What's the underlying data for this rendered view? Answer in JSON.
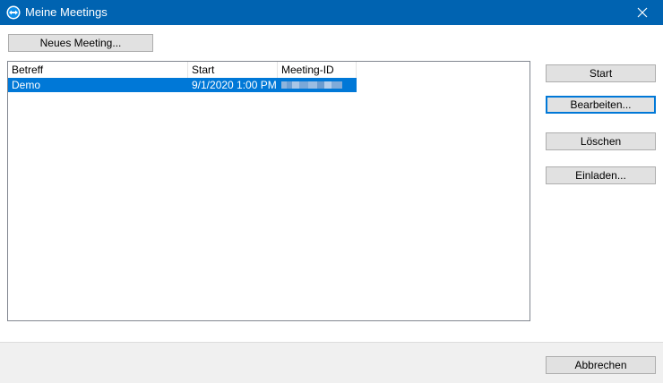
{
  "window": {
    "title": "Meine Meetings",
    "icon": "teamviewer-icon"
  },
  "buttons": {
    "new_meeting": "Neues Meeting...",
    "start": "Start",
    "edit": "Bearbeiten...",
    "delete": "Löschen",
    "invite": "Einladen...",
    "cancel": "Abbrechen"
  },
  "table": {
    "columns": [
      "Betreff",
      "Start",
      "Meeting-ID"
    ],
    "rows": [
      {
        "subject": "Demo",
        "start": "9/1/2020 1:00 PM",
        "meeting_id": ""
      }
    ]
  },
  "colors": {
    "titlebar": "#0063b1",
    "selection": "#0078d7"
  }
}
